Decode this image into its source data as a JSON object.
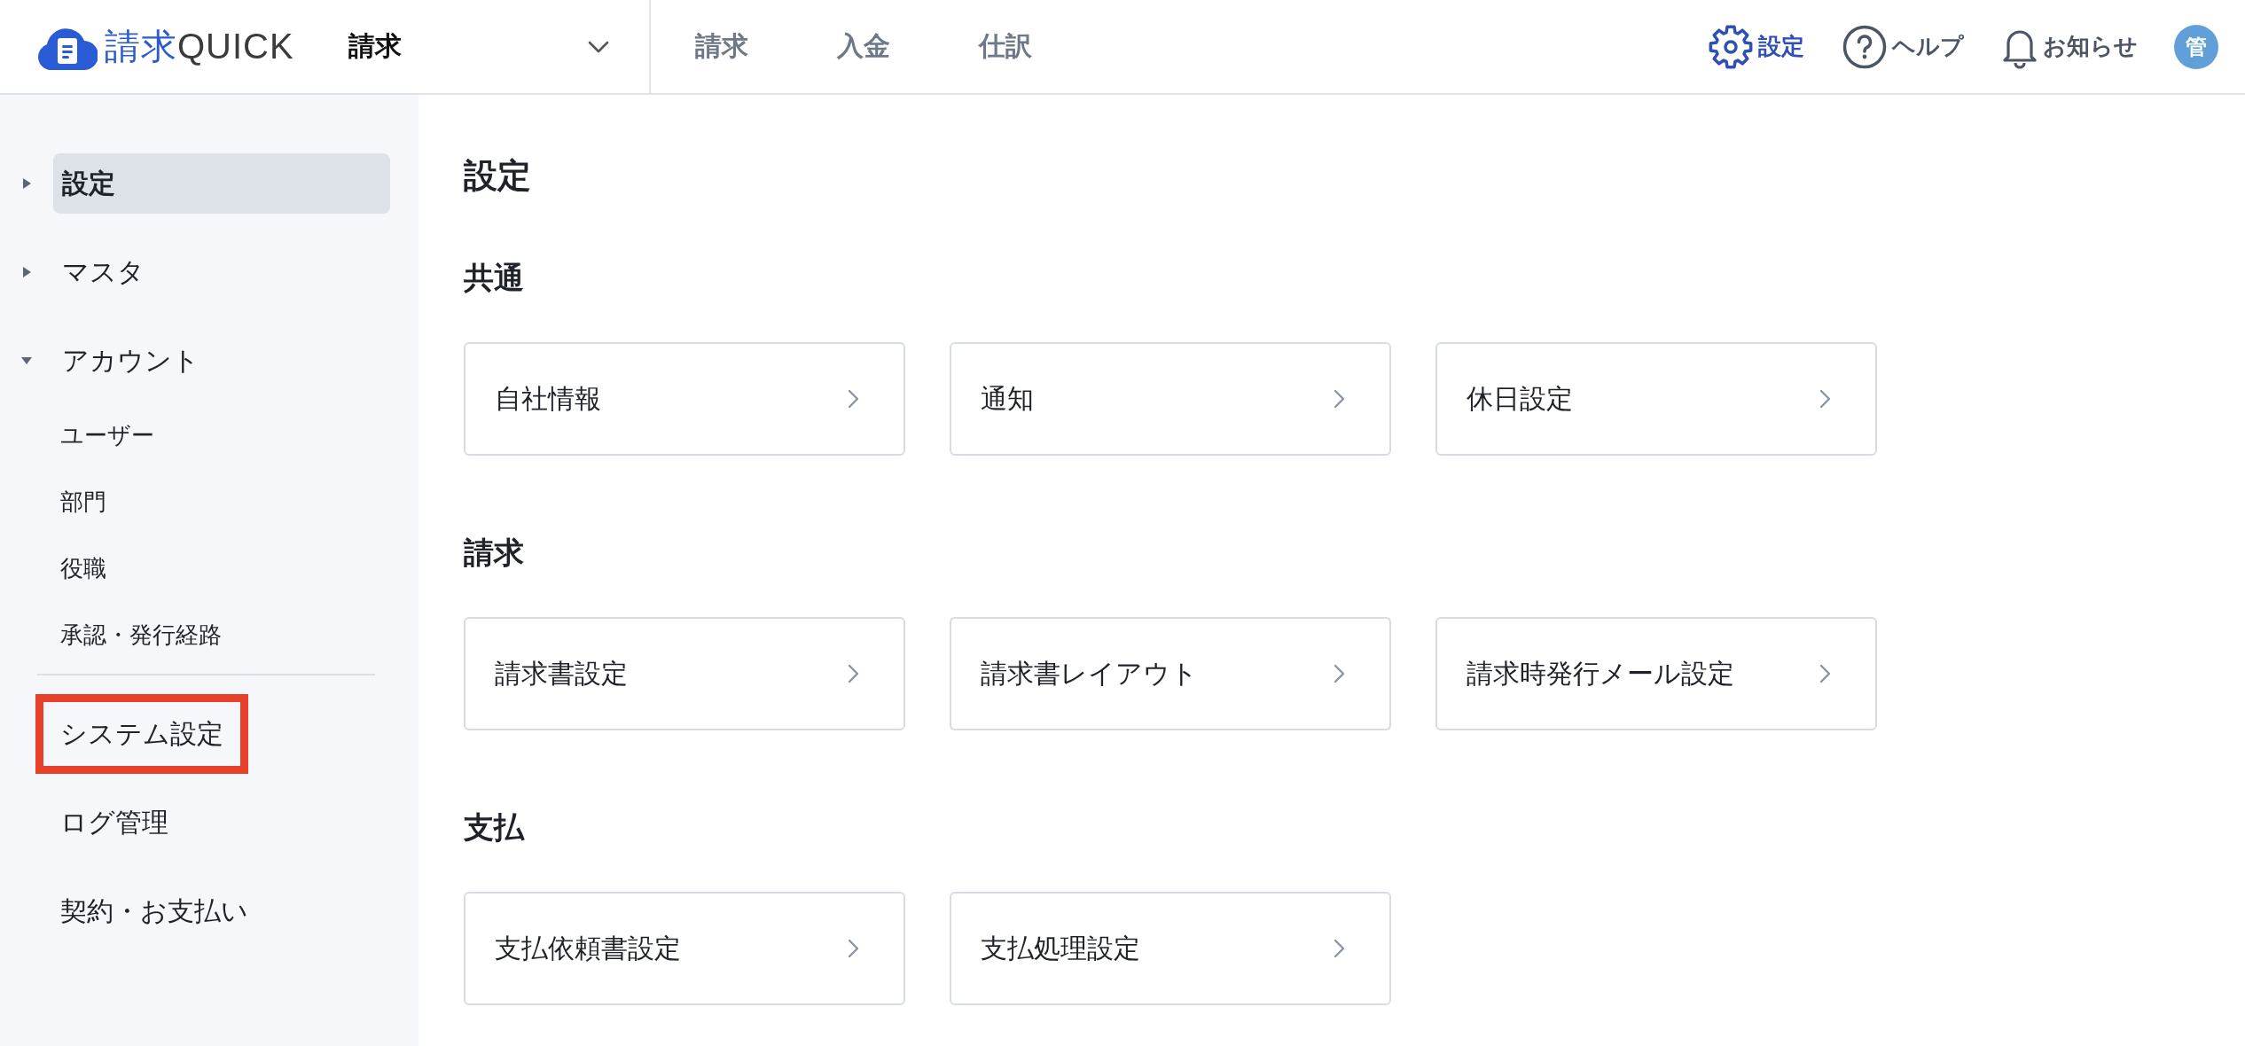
{
  "header": {
    "logo": {
      "kanji": "請求",
      "latin": "QUICK"
    },
    "app_switcher": {
      "label": "請求"
    },
    "tabs": [
      {
        "label": "請求",
        "selected": false
      },
      {
        "label": "入金",
        "selected": false
      },
      {
        "label": "仕訳",
        "selected": false
      }
    ],
    "actions": [
      {
        "kind": "settings",
        "label": "設定",
        "selected": true
      },
      {
        "kind": "help",
        "label": "ヘルプ",
        "selected": false
      },
      {
        "kind": "notifications",
        "label": "お知らせ",
        "selected": false
      }
    ],
    "avatar": {
      "initial": "管"
    }
  },
  "sidebar": {
    "items": [
      {
        "label": "設定",
        "selected": true,
        "expanded": false
      },
      {
        "label": "マスタ",
        "selected": false,
        "expanded": false
      },
      {
        "label": "アカウント",
        "selected": false,
        "expanded": true,
        "children": [
          {
            "label": "ユーザー",
            "selected": false
          },
          {
            "label": "部門",
            "selected": false
          },
          {
            "label": "役職",
            "selected": false
          },
          {
            "label": "承認・発行経路",
            "selected": false
          }
        ]
      }
    ],
    "footer_items": [
      {
        "label": "システム設定",
        "selected": false,
        "highlighted": true
      },
      {
        "label": "ログ管理",
        "selected": false,
        "highlighted": false
      },
      {
        "label": "契約・お支払い",
        "selected": false,
        "highlighted": false
      }
    ]
  },
  "page": {
    "title": "設定",
    "sections": [
      {
        "title": "共通",
        "cards": [
          {
            "label": "自社情報"
          },
          {
            "label": "通知"
          },
          {
            "label": "休日設定"
          }
        ]
      },
      {
        "title": "請求",
        "cards": [
          {
            "label": "請求書設定"
          },
          {
            "label": "請求書レイアウト"
          },
          {
            "label": "請求時発行メール設定"
          }
        ]
      },
      {
        "title": "支払",
        "cards": [
          {
            "label": "支払依頼書設定"
          },
          {
            "label": "支払処理設定"
          }
        ]
      }
    ]
  }
}
